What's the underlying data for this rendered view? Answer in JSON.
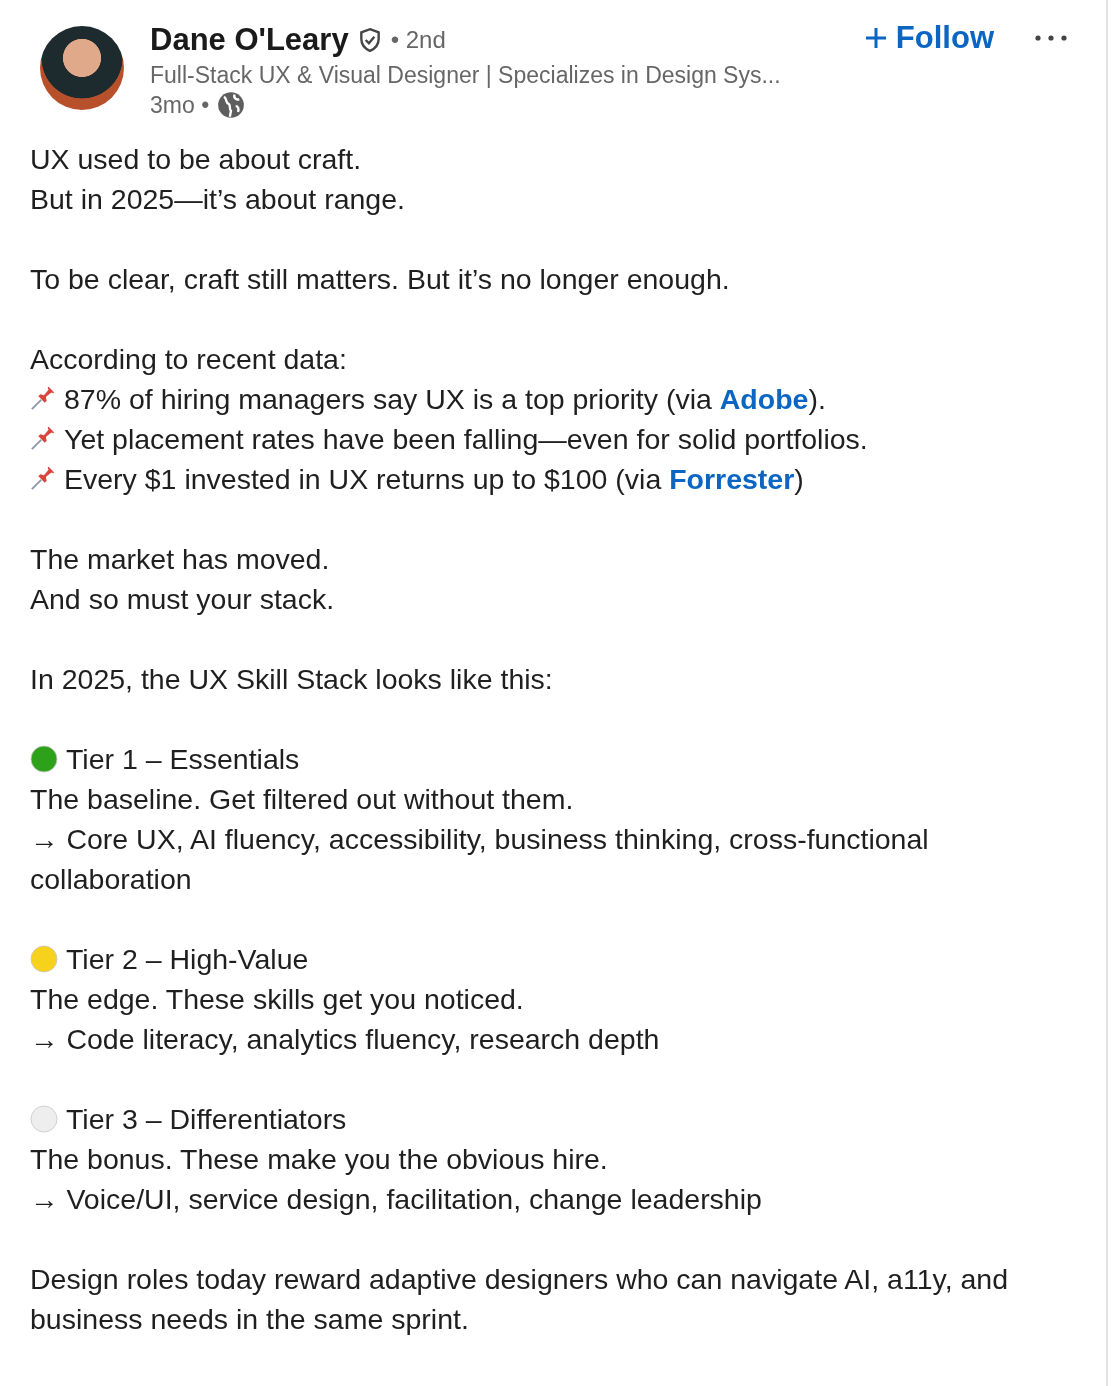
{
  "author": {
    "name": "Dane O'Leary",
    "degree": "• 2nd",
    "headline": "Full-Stack UX & Visual Designer | Specializes in Design Sys...",
    "time": "3mo •"
  },
  "follow_button": {
    "label": "Follow"
  },
  "body": [
    {
      "lines": [
        {
          "kind": "text",
          "segments": [
            {
              "text": "UX used to be about craft."
            }
          ]
        },
        {
          "kind": "text",
          "segments": [
            {
              "text": "But in 2025—it’s about range."
            }
          ]
        }
      ]
    },
    {
      "lines": [
        {
          "kind": "text",
          "segments": [
            {
              "text": "To be clear, craft still matters. But it’s no longer enough."
            }
          ]
        }
      ]
    },
    {
      "lines": [
        {
          "kind": "text",
          "segments": [
            {
              "text": "According to recent data:"
            }
          ]
        },
        {
          "kind": "pin",
          "segments": [
            {
              "text": "87% of hiring managers say UX is a top priority (via "
            },
            {
              "text": "Adobe",
              "link": true
            },
            {
              "text": ")."
            }
          ]
        },
        {
          "kind": "pin",
          "segments": [
            {
              "text": "Yet placement rates have been falling—even for solid portfolios."
            }
          ]
        },
        {
          "kind": "pin",
          "segments": [
            {
              "text": "Every $1 invested in UX returns up to $100 (via "
            },
            {
              "text": "Forrester",
              "link": true
            },
            {
              "text": ")"
            }
          ]
        }
      ]
    },
    {
      "lines": [
        {
          "kind": "text",
          "segments": [
            {
              "text": "The market has moved."
            }
          ]
        },
        {
          "kind": "text",
          "segments": [
            {
              "text": "And so must your stack."
            }
          ]
        }
      ]
    },
    {
      "lines": [
        {
          "kind": "text",
          "segments": [
            {
              "text": "In 2025, the UX Skill Stack looks like this:"
            }
          ]
        }
      ]
    },
    {
      "lines": [
        {
          "kind": "dot",
          "color": "#2ea11a",
          "segments": [
            {
              "text": "Tier 1 – Essentials"
            }
          ]
        },
        {
          "kind": "text",
          "segments": [
            {
              "text": "The baseline. Get filtered out without them."
            }
          ]
        },
        {
          "kind": "text",
          "segments": [
            {
              "text": "→ Core UX, AI fluency, accessibility, business thinking, cross-functional collaboration"
            }
          ]
        }
      ]
    },
    {
      "lines": [
        {
          "kind": "dot",
          "color": "#f7d21c",
          "segments": [
            {
              "text": "Tier 2 – High-Value"
            }
          ]
        },
        {
          "kind": "text",
          "segments": [
            {
              "text": "The edge. These skills get you noticed."
            }
          ]
        },
        {
          "kind": "text",
          "segments": [
            {
              "text": "→ Code literacy, analytics fluency, research depth"
            }
          ]
        }
      ]
    },
    {
      "lines": [
        {
          "kind": "dot",
          "color": "#eeeeee",
          "segments": [
            {
              "text": "Tier 3 – Differentiators"
            }
          ]
        },
        {
          "kind": "text",
          "segments": [
            {
              "text": "The bonus. These make you the obvious hire."
            }
          ]
        },
        {
          "kind": "text",
          "segments": [
            {
              "text": "→ Voice/UI, service design, facilitation, change leadership"
            }
          ]
        }
      ]
    },
    {
      "lines": [
        {
          "kind": "text",
          "segments": [
            {
              "text": "Design roles today reward adaptive designers who can navigate AI, a11y, and business needs in the same sprint."
            }
          ]
        }
      ]
    }
  ]
}
